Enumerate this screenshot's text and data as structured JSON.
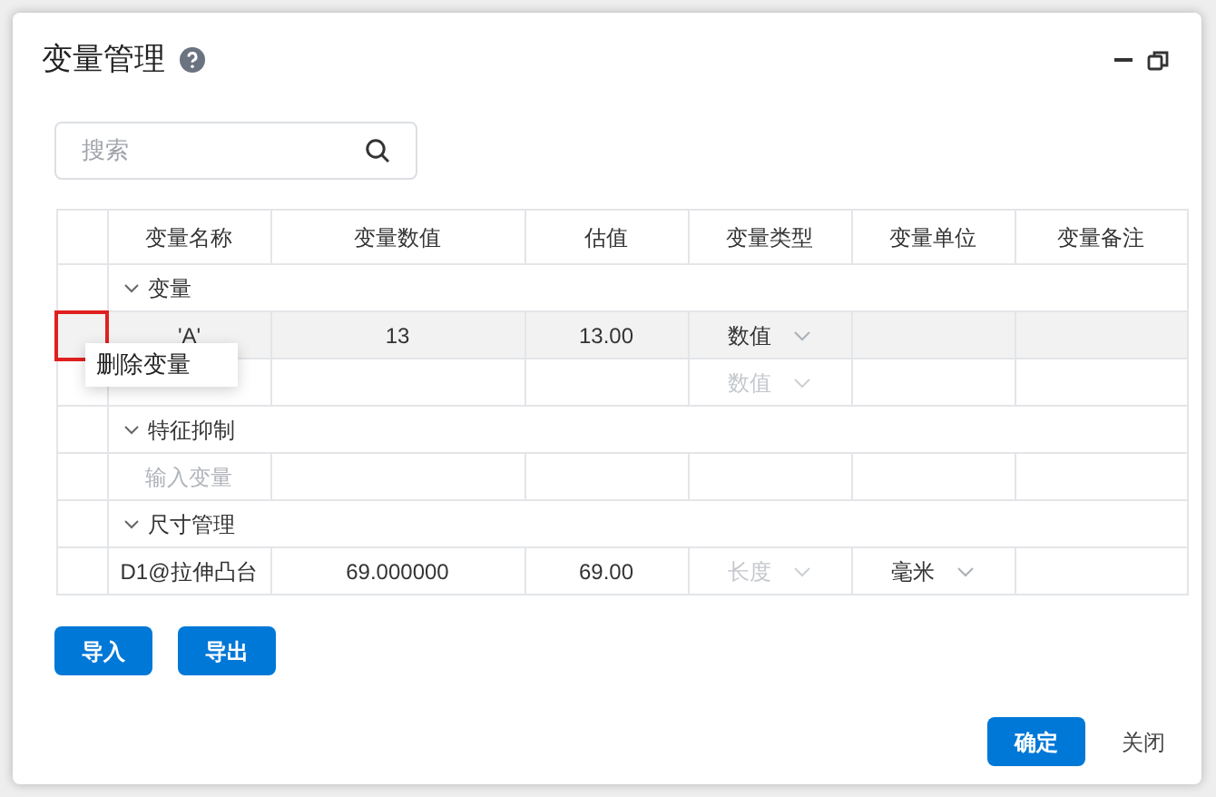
{
  "window": {
    "title": "变量管理"
  },
  "search": {
    "placeholder": "搜索"
  },
  "table": {
    "columns": [
      "变量名称",
      "变量数值",
      "估值",
      "变量类型",
      "变量单位",
      "变量备注"
    ],
    "rows": [
      {
        "kind": "group",
        "label": "变量",
        "expanded": true
      },
      {
        "kind": "variable",
        "selected": true,
        "name": "'A'",
        "value": "13",
        "estimate": "13.00",
        "type": "数值",
        "type_disabled": false
      },
      {
        "kind": "variable",
        "selected": false,
        "type": "数值",
        "type_disabled": true
      },
      {
        "kind": "group",
        "label": "特征抑制",
        "expanded": true
      },
      {
        "kind": "input",
        "placeholder": "输入变量"
      },
      {
        "kind": "group",
        "label": "尺寸管理",
        "expanded": true
      },
      {
        "kind": "variable",
        "selected": false,
        "name": "D1@拉伸凸台",
        "value": "69.000000",
        "estimate": "69.00",
        "type": "长度",
        "type_disabled": true,
        "unit": "毫米"
      }
    ]
  },
  "context_menu": {
    "items": [
      "删除变量"
    ]
  },
  "buttons": [
    "导入",
    "导出"
  ],
  "footer": {
    "confirm": "确定",
    "close": "关闭"
  }
}
